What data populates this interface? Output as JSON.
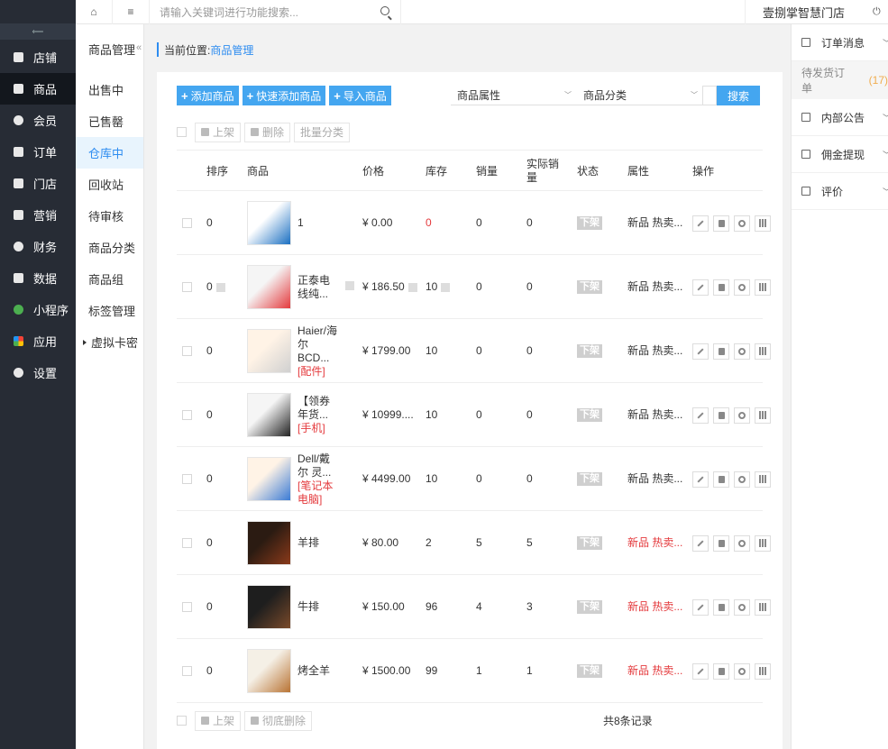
{
  "sidebar": {
    "items": [
      {
        "label": "店铺",
        "icon": "store-icon"
      },
      {
        "label": "商品",
        "icon": "goods-icon",
        "active": true
      },
      {
        "label": "会员",
        "icon": "member-icon"
      },
      {
        "label": "订单",
        "icon": "order-icon"
      },
      {
        "label": "门店",
        "icon": "shop-icon"
      },
      {
        "label": "营销",
        "icon": "gift-icon"
      },
      {
        "label": "财务",
        "icon": "money-bag-icon"
      },
      {
        "label": "数据",
        "icon": "chart-icon"
      },
      {
        "label": "小程序",
        "icon": "miniprogram-icon"
      },
      {
        "label": "应用",
        "icon": "apps-icon"
      },
      {
        "label": "设置",
        "icon": "gear-icon"
      }
    ]
  },
  "topbar": {
    "search_placeholder": "请输入关键词进行功能搜索...",
    "store_name": "壹捌掌智慧门店"
  },
  "subnav": {
    "title": "商品管理",
    "items": [
      {
        "label": "出售中"
      },
      {
        "label": "已售罄"
      },
      {
        "label": "仓库中",
        "active": true
      },
      {
        "label": "回收站"
      },
      {
        "label": "待审核"
      },
      {
        "label": "商品分类"
      },
      {
        "label": "商品组"
      },
      {
        "label": "标签管理"
      },
      {
        "label": "虚拟卡密"
      }
    ]
  },
  "breadcrumb": {
    "prefix": "当前位置:",
    "current": "商品管理"
  },
  "toolbar": {
    "add_label": "添加商品",
    "quick_add_label": "快速添加商品",
    "import_label": "导入商品",
    "attr_filter": "商品属性",
    "cat_filter": "商品分类",
    "search_label": "搜索"
  },
  "bulk": {
    "shelve_label": "上架",
    "delete_label": "删除",
    "batch_cat_label": "批量分类",
    "purge_label": "彻底删除"
  },
  "table": {
    "headers": {
      "sort": "排序",
      "product": "商品",
      "price": "价格",
      "stock": "库存",
      "sales": "销量",
      "actual_sales": "实际销量",
      "status": "状态",
      "attrs": "属性",
      "ops": "操作"
    },
    "rows": [
      {
        "sort": "0",
        "name1": "1",
        "name2": "",
        "cat": "",
        "price": "¥ 0.00",
        "stock": "0",
        "sales": "0",
        "actual": "0",
        "status": "下架",
        "attrs": "新品 热卖...",
        "attr_red": false,
        "stock_red": true
      },
      {
        "sort": "0",
        "name1": "正泰电",
        "name2": "线纯...",
        "cat": "",
        "price": "¥ 186.50",
        "stock": "10",
        "sales": "0",
        "actual": "0",
        "status": "下架",
        "attrs": "新品 热卖...",
        "attr_red": false,
        "stock_red": false
      },
      {
        "sort": "0",
        "name1": "Haier/海",
        "name2": "尔 BCD...",
        "cat": "[配件]",
        "price": "¥ 1799.00",
        "stock": "10",
        "sales": "0",
        "actual": "0",
        "status": "下架",
        "attrs": "新品 热卖...",
        "attr_red": false,
        "stock_red": false
      },
      {
        "sort": "0",
        "name1": "【领券",
        "name2": "年货...",
        "cat": "[手机]",
        "price": "¥ 10999....",
        "stock": "10",
        "sales": "0",
        "actual": "0",
        "status": "下架",
        "attrs": "新品 热卖...",
        "attr_red": false,
        "stock_red": false
      },
      {
        "sort": "0",
        "name1": "Dell/戴",
        "name2": "尔 灵...",
        "cat": "[笔记本电脑]",
        "price": "¥ 4499.00",
        "stock": "10",
        "sales": "0",
        "actual": "0",
        "status": "下架",
        "attrs": "新品 热卖...",
        "attr_red": false,
        "stock_red": false
      },
      {
        "sort": "0",
        "name1": "羊排",
        "name2": "",
        "cat": "",
        "price": "¥ 80.00",
        "stock": "2",
        "sales": "5",
        "actual": "5",
        "status": "下架",
        "attrs": "新品 热卖...",
        "attr_red": true,
        "stock_red": false
      },
      {
        "sort": "0",
        "name1": "牛排",
        "name2": "",
        "cat": "",
        "price": "¥ 150.00",
        "stock": "96",
        "sales": "4",
        "actual": "3",
        "status": "下架",
        "attrs": "新品 热卖...",
        "attr_red": true,
        "stock_red": false
      },
      {
        "sort": "0",
        "name1": "烤全羊",
        "name2": "",
        "cat": "",
        "price": "¥ 1500.00",
        "stock": "99",
        "sales": "1",
        "actual": "1",
        "status": "下架",
        "attrs": "新品 热卖...",
        "attr_red": true,
        "stock_red": false
      }
    ],
    "total": "共8条记录"
  },
  "rpanel": {
    "order_msg": "订单消息",
    "pending_ship": "待发货订单",
    "pending_count": "(17)",
    "notice": "内部公告",
    "commission": "佣金提现",
    "review": "评价"
  },
  "colors": {
    "accent": "#44a6f0",
    "sidebar": "#272c35",
    "red": "#e4393c"
  }
}
